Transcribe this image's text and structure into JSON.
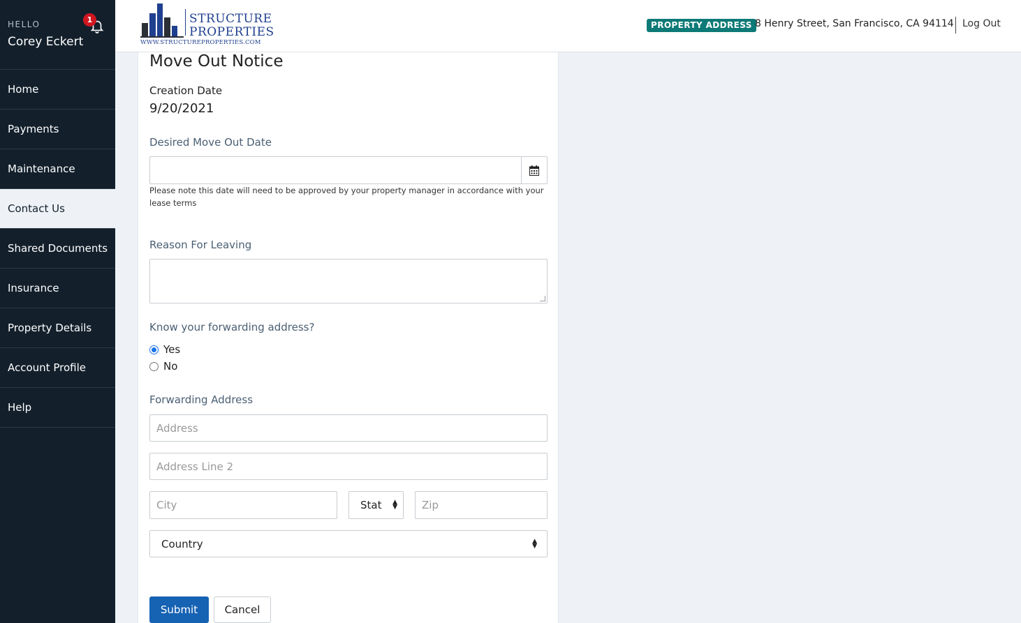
{
  "user": {
    "greeting": "HELLO",
    "name": "Corey Eckert",
    "notification_count": "1"
  },
  "nav": {
    "items": [
      {
        "label": "Home",
        "active": false
      },
      {
        "label": "Payments",
        "active": false
      },
      {
        "label": "Maintenance",
        "active": false
      },
      {
        "label": "Contact Us",
        "active": true
      },
      {
        "label": "Shared Documents",
        "active": false
      },
      {
        "label": "Insurance",
        "active": false
      },
      {
        "label": "Property Details",
        "active": false
      },
      {
        "label": "Account Profile",
        "active": false
      },
      {
        "label": "Help",
        "active": false
      }
    ]
  },
  "header": {
    "logo": {
      "line1": "STRUCTURE",
      "line2": "PROPERTIES",
      "url": "WWW.STRUCTUREPROPERTIES.COM"
    },
    "property_badge": "PROPERTY ADDRESS",
    "property_address": "8 Henry Street, San Francisco, CA 94114",
    "logout": "Log Out"
  },
  "form": {
    "title": "Move Out Notice",
    "creation_date_label": "Creation Date",
    "creation_date_value": "9/20/2021",
    "move_out_label": "Desired Move Out Date",
    "move_out_value": "",
    "move_out_note": "Please note this date will need to be approved by your property manager in accordance with your lease terms",
    "reason_label": "Reason For Leaving",
    "reason_value": "",
    "forwarding_question": "Know your forwarding address?",
    "options": {
      "yes": "Yes",
      "no": "No",
      "selected": "Yes"
    },
    "forwarding_label": "Forwarding Address",
    "address_placeholder": "Address",
    "address2_placeholder": "Address Line 2",
    "city_placeholder": "City",
    "state_value": "Stat",
    "zip_placeholder": "Zip",
    "country_value": "Country",
    "submit": "Submit",
    "cancel": "Cancel"
  },
  "colors": {
    "sidebar": "#13202c",
    "badge": "#0e7a77",
    "primary": "#1662b3",
    "notification": "#d0161f"
  }
}
